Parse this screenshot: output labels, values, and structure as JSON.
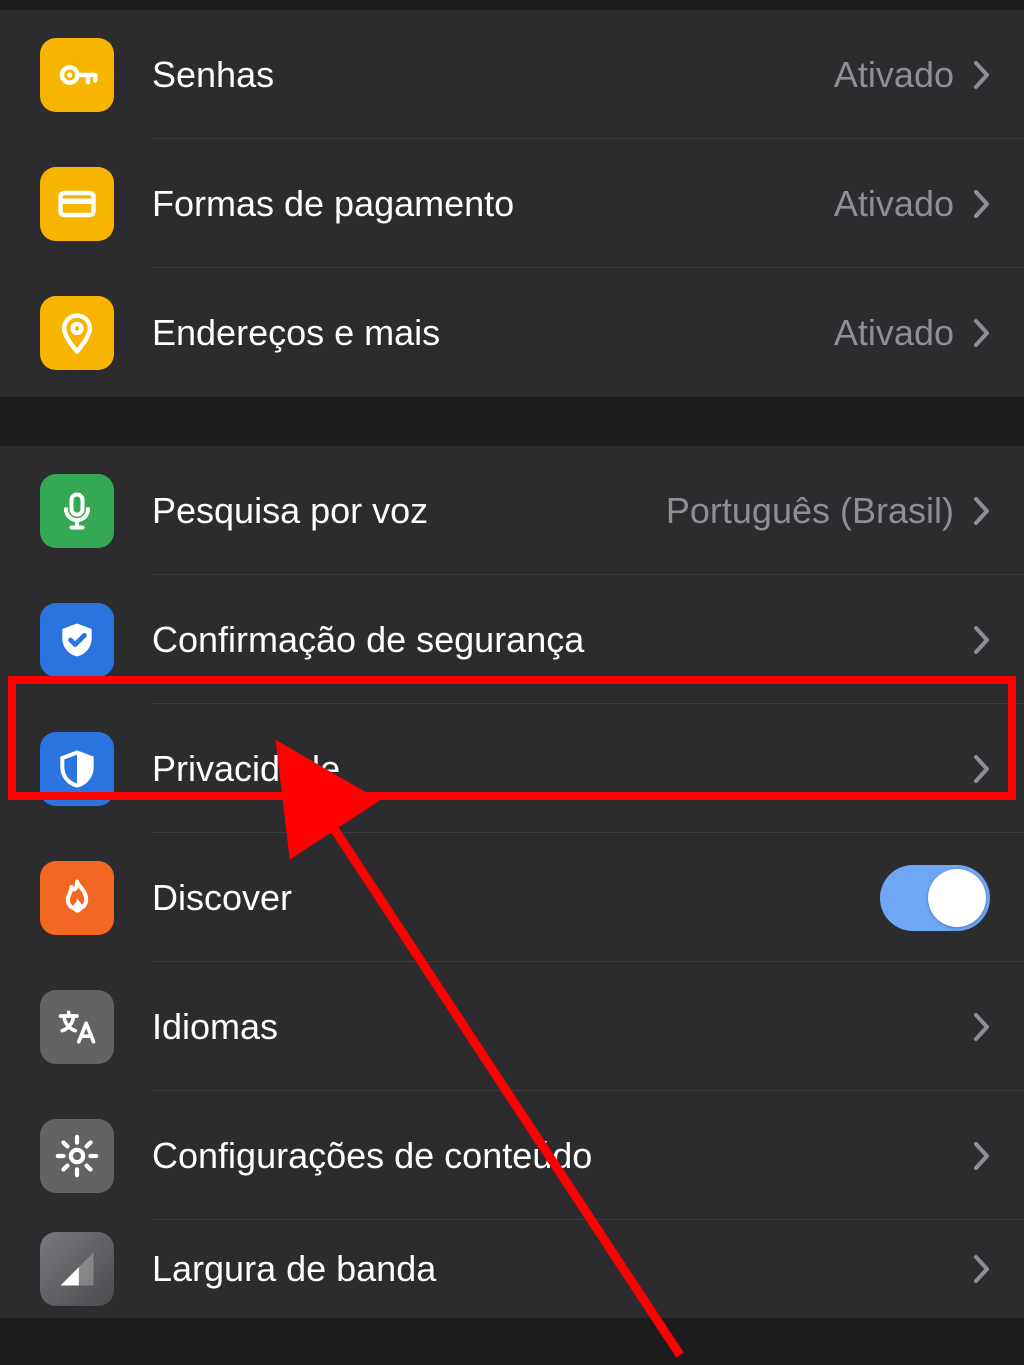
{
  "group1": {
    "passwords": {
      "label": "Senhas",
      "value": "Ativado",
      "icon": "key-icon"
    },
    "payment": {
      "label": "Formas de pagamento",
      "value": "Ativado",
      "icon": "card-icon"
    },
    "addresses": {
      "label": "Endereços e mais",
      "value": "Ativado",
      "icon": "pin-icon"
    }
  },
  "group2": {
    "voice": {
      "label": "Pesquisa por voz",
      "value": "Português (Brasil)",
      "icon": "mic-icon"
    },
    "security": {
      "label": "Confirmação de segurança",
      "icon": "shield-check-icon"
    },
    "privacy": {
      "label": "Privacidade",
      "icon": "shield-half-icon"
    },
    "discover": {
      "label": "Discover",
      "icon": "flame-icon",
      "toggle": true
    },
    "languages": {
      "label": "Idiomas",
      "icon": "translate-icon"
    },
    "content": {
      "label": "Configurações de conteúdo",
      "icon": "gear-icon"
    },
    "bandwidth": {
      "label": "Largura de banda",
      "icon": "signal-icon"
    }
  },
  "annotation": {
    "highlight_target": "privacy",
    "color": "#ff0000"
  }
}
